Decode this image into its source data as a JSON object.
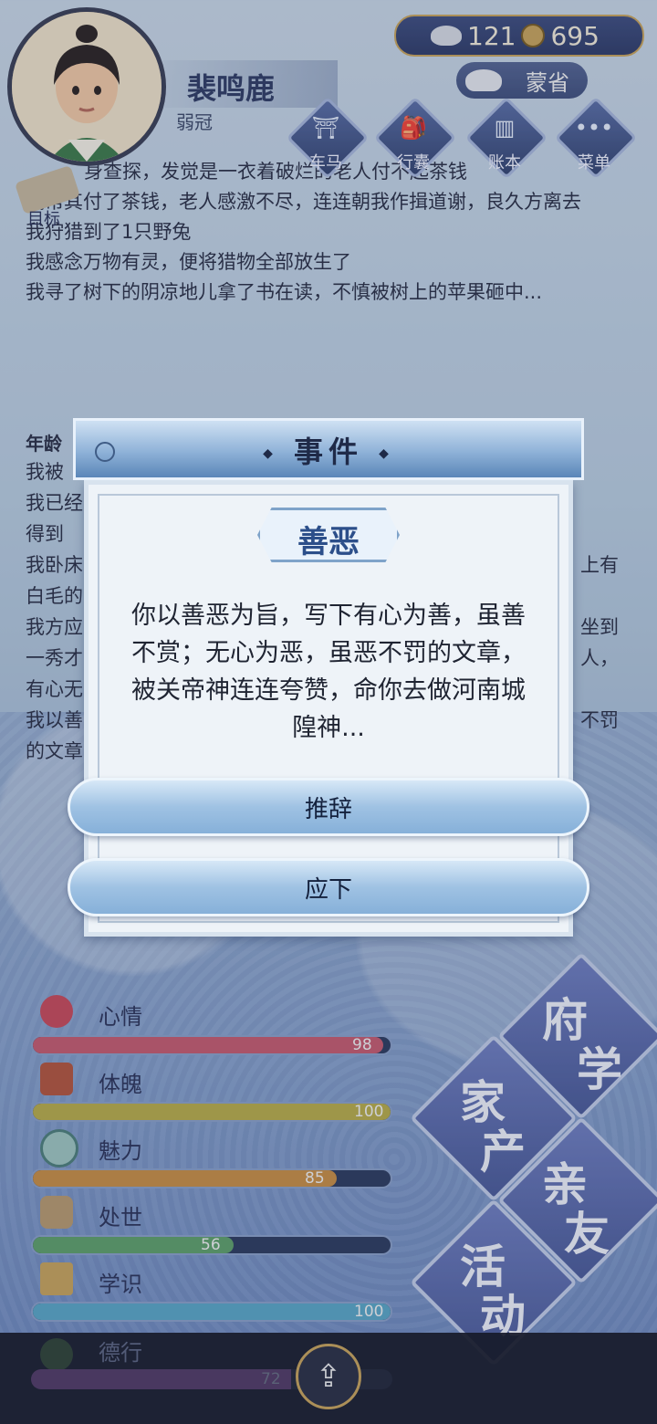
{
  "player": {
    "name": "裴鸣鹿",
    "age_title": "弱冠"
  },
  "currency": {
    "silver": "121",
    "copper": "695"
  },
  "rank": "蒙省",
  "menu": [
    {
      "label": "车马",
      "icon": "carriage-icon"
    },
    {
      "label": "行囊",
      "icon": "bag-icon"
    },
    {
      "label": "账本",
      "icon": "ledger-icon"
    },
    {
      "label": "菜单",
      "icon": "more-icon"
    }
  ],
  "target_label": "目标",
  "log": [
    "身查探，发觉是一衣着破烂的老人付不起茶钱",
    "我帮其付了茶钱，老人感激不尽，连连朝我作揖道谢，良久方离去",
    "我狩猎到了1只野兔",
    "我感念万物有灵，便将猎物全部放生了",
    "我寻了树下的阴凉地儿拿了书在读，不慎被树上的苹果砸中..."
  ],
  "age_heading": "年龄",
  "log2": [
    "我被",
    "我已经",
    "得到",
    "我卧床",
    "白毛的",
    "我方应",
    "一秀才",
    "有心无",
    "我以善",
    "的文章"
  ],
  "log2_right": [
    "上有",
    "坐到",
    "人，",
    "不罚"
  ],
  "dialog": {
    "title": "事件",
    "tag": "善恶",
    "text": "你以善恶为旨，写下有心为善，虽善不赏；无心为恶，虽恶不罚的文章，被关帝神连连夸赞，命你去做河南城隍神...",
    "option1": "推辞",
    "option2": "应下"
  },
  "stats": [
    {
      "label": "心情",
      "value": 98,
      "max": 100,
      "color": "#c65b6e",
      "icon": "flower-icon"
    },
    {
      "label": "体魄",
      "value": 100,
      "max": 100,
      "color": "#b9ad48",
      "icon": "drum-icon"
    },
    {
      "label": "魅力",
      "value": 85,
      "max": 100,
      "color": "#c98e44",
      "icon": "mirror-icon"
    },
    {
      "label": "处世",
      "value": 56,
      "max": 100,
      "color": "#5ea06a",
      "icon": "scroll-icon"
    },
    {
      "label": "学识",
      "value": 100,
      "max": 100,
      "color": "#5aa6c6",
      "icon": "books-icon"
    },
    {
      "label": "德行",
      "value": 72,
      "max": 100,
      "color": "#8a4f9a",
      "icon": "jade-icon"
    }
  ],
  "actions": [
    {
      "l1": "府",
      "l2": "学"
    },
    {
      "l1": "家",
      "l2": "产"
    },
    {
      "l1": "亲",
      "l2": "友"
    },
    {
      "l1": "活",
      "l2": "动"
    }
  ]
}
